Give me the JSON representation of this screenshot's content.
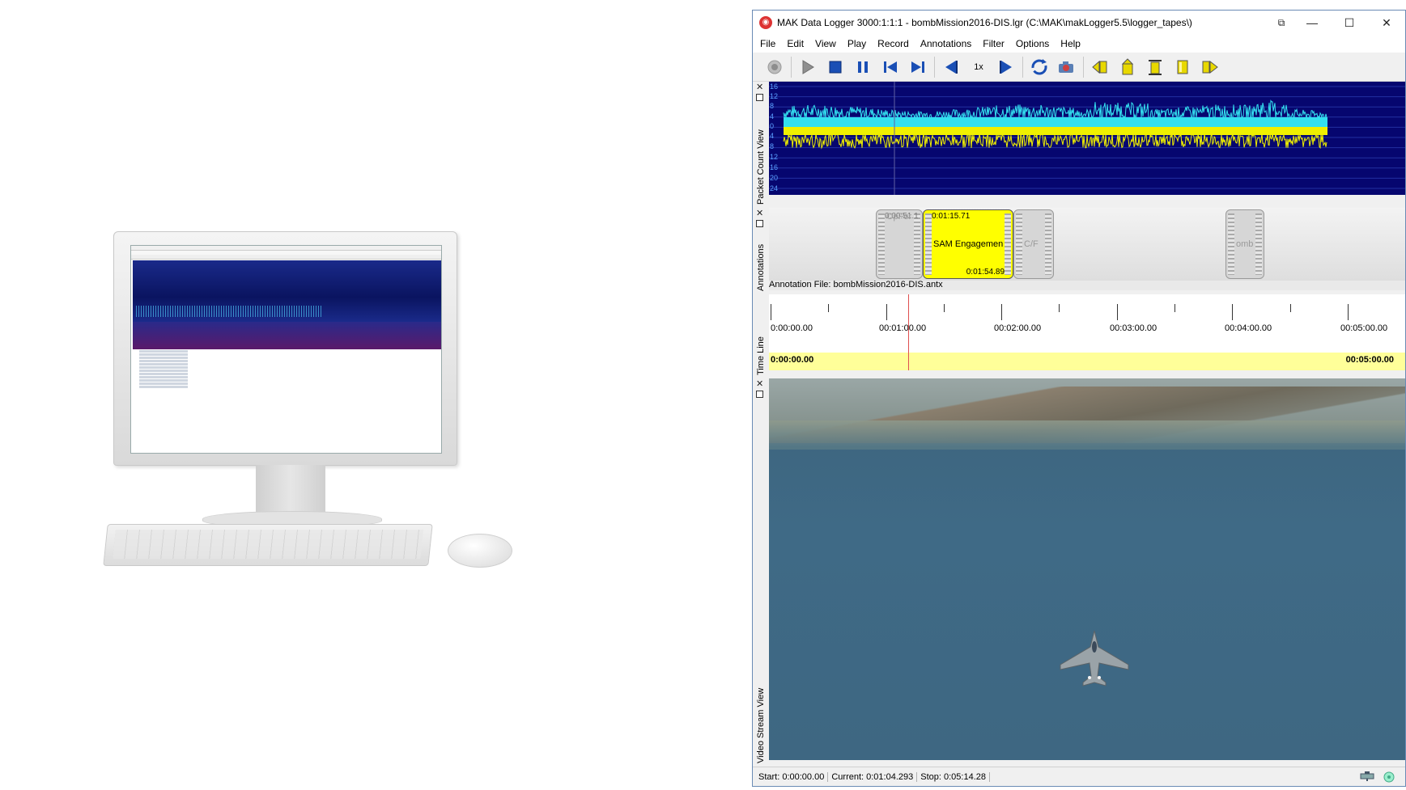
{
  "window": {
    "title": "MAK Data Logger 3000:1:1:1 - bombMission2016-DIS.lgr (C:\\MAK\\makLogger5.5\\logger_tapes\\)",
    "controls": {
      "restore_small": "⧉",
      "minimize": "—",
      "maximize": "☐",
      "close": "✕"
    }
  },
  "menu": [
    "File",
    "Edit",
    "View",
    "Play",
    "Record",
    "Annotations",
    "Filter",
    "Options",
    "Help"
  ],
  "toolbar": {
    "speed_label": "1x",
    "icons": [
      "record-icon",
      "play-icon",
      "stop-icon",
      "pause-icon",
      "skip-start-icon",
      "skip-end-icon",
      "slow-down-icon",
      "speed-up-icon",
      "loop-icon",
      "camera-icon",
      "annotation-prev-icon",
      "annotation-add-icon",
      "annotation-list-icon",
      "annotation-edit-icon",
      "annotation-next-icon"
    ],
    "accent_color": "#1a4fb5",
    "annotation_color": "#e8d800"
  },
  "panels": {
    "packet_count": {
      "label": "Packet Count View",
      "y_labels": [
        "16",
        "12",
        "8",
        "4",
        "0",
        "4",
        "8",
        "12",
        "16",
        "20",
        "24"
      ],
      "background": "#06066f",
      "series_colors": [
        "#33e0f0",
        "#f0f000"
      ]
    },
    "annotations": {
      "label": "Annotations",
      "file_label": "Annotation File: bombMission2016-DIS.antx",
      "items": [
        {
          "text": "OpFor R...",
          "start": "0:00:51.1"
        },
        {
          "text": "SAM Engagement",
          "start": "0:01:15.71",
          "end": "0:01:54.89"
        },
        {
          "text": "C/F"
        },
        {
          "text": "omb F..."
        }
      ]
    },
    "timeline": {
      "label": "Time Line",
      "tick_labels": [
        "0:00:00.00",
        "00:01:00.00",
        "00:02:00.00",
        "00:03:00.00",
        "00:04:00.00",
        "00:05:00.00"
      ],
      "range_start": "0:00:00.00",
      "range_end": "00:05:00.00"
    },
    "video": {
      "label": "Video Stream View"
    }
  },
  "status": {
    "start": "Start: 0:00:00.00",
    "current": "Current: 0:01:04.293",
    "stop": "Stop: 0:05:14.28"
  }
}
